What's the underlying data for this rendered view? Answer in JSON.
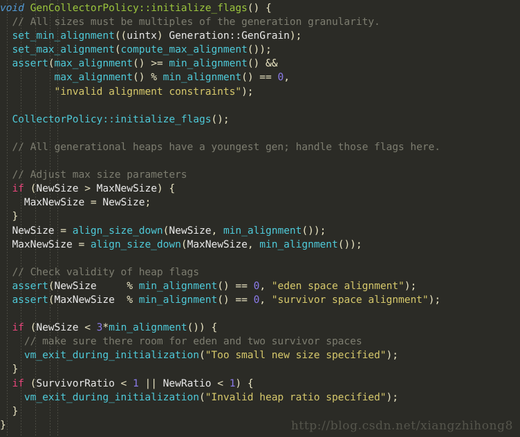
{
  "editor": {
    "language": "C++",
    "background_color": "#2b2b26",
    "font_size_px": 14.6,
    "line_height_px": 20.1,
    "indent_guide_color": "#4a4a42",
    "indent_guide_x": [
      10,
      30,
      51,
      72,
      83
    ]
  },
  "theme": {
    "keyword": "#e8467c",
    "type_keyword": "#529ad6",
    "function": "#4ec9d8",
    "declaration": "#9bc53d",
    "string": "#d6c86b",
    "comment": "#7d7d70",
    "number": "#8a7ae8",
    "plain": "#e8e8e8",
    "punctuation": "#e9e4c2"
  },
  "watermark": {
    "text": "http://blog.csdn.net/xiangzhihong8"
  },
  "code": {
    "lines": [
      {
        "n": 1,
        "tokens": [
          {
            "t": "void",
            "c": "kwt"
          },
          {
            "t": " ",
            "c": "pl"
          },
          {
            "t": "GenCollectorPolicy::initialize_flags",
            "c": "decl"
          },
          {
            "t": "() {",
            "c": "pn"
          }
        ]
      },
      {
        "n": 2,
        "tokens": [
          {
            "t": "  ",
            "c": "pl"
          },
          {
            "t": "// All sizes must be multiples of the generation granularity.",
            "c": "cmt"
          }
        ]
      },
      {
        "n": 3,
        "tokens": [
          {
            "t": "  ",
            "c": "pl"
          },
          {
            "t": "set_min_alignment",
            "c": "fn"
          },
          {
            "t": "((",
            "c": "pn"
          },
          {
            "t": "uintx",
            "c": "pl"
          },
          {
            "t": ") ",
            "c": "pn"
          },
          {
            "t": "Generation::GenGrain",
            "c": "pl"
          },
          {
            "t": ");",
            "c": "pn"
          }
        ]
      },
      {
        "n": 4,
        "tokens": [
          {
            "t": "  ",
            "c": "pl"
          },
          {
            "t": "set_max_alignment",
            "c": "fn"
          },
          {
            "t": "(",
            "c": "pn"
          },
          {
            "t": "compute_max_alignment",
            "c": "fn"
          },
          {
            "t": "());",
            "c": "pn"
          }
        ]
      },
      {
        "n": 5,
        "tokens": [
          {
            "t": "  ",
            "c": "pl"
          },
          {
            "t": "assert",
            "c": "fn"
          },
          {
            "t": "(",
            "c": "pn"
          },
          {
            "t": "max_alignment",
            "c": "fn"
          },
          {
            "t": "() ",
            "c": "pn"
          },
          {
            "t": ">=",
            "c": "op"
          },
          {
            "t": " ",
            "c": "pl"
          },
          {
            "t": "min_alignment",
            "c": "fn"
          },
          {
            "t": "() ",
            "c": "pn"
          },
          {
            "t": "&&",
            "c": "op"
          }
        ]
      },
      {
        "n": 6,
        "tokens": [
          {
            "t": "         ",
            "c": "pl"
          },
          {
            "t": "max_alignment",
            "c": "fn"
          },
          {
            "t": "() ",
            "c": "pn"
          },
          {
            "t": "%",
            "c": "op"
          },
          {
            "t": " ",
            "c": "pl"
          },
          {
            "t": "min_alignment",
            "c": "fn"
          },
          {
            "t": "() ",
            "c": "pn"
          },
          {
            "t": "==",
            "c": "op"
          },
          {
            "t": " ",
            "c": "pl"
          },
          {
            "t": "0",
            "c": "num"
          },
          {
            "t": ",",
            "c": "pn"
          }
        ]
      },
      {
        "n": 7,
        "tokens": [
          {
            "t": "         ",
            "c": "pl"
          },
          {
            "t": "\"invalid alignment constraints\"",
            "c": "str"
          },
          {
            "t": ");",
            "c": "pn"
          }
        ]
      },
      {
        "n": 8,
        "tokens": []
      },
      {
        "n": 9,
        "tokens": [
          {
            "t": "  ",
            "c": "pl"
          },
          {
            "t": "CollectorPolicy::initialize_flags",
            "c": "fn"
          },
          {
            "t": "();",
            "c": "pn"
          }
        ]
      },
      {
        "n": 10,
        "tokens": []
      },
      {
        "n": 11,
        "tokens": [
          {
            "t": "  ",
            "c": "pl"
          },
          {
            "t": "// All generational heaps have a youngest gen; handle those flags here.",
            "c": "cmt"
          }
        ]
      },
      {
        "n": 12,
        "tokens": []
      },
      {
        "n": 13,
        "tokens": [
          {
            "t": "  ",
            "c": "pl"
          },
          {
            "t": "// Adjust max size parameters",
            "c": "cmt"
          }
        ]
      },
      {
        "n": 14,
        "tokens": [
          {
            "t": "  ",
            "c": "pl"
          },
          {
            "t": "if",
            "c": "kw"
          },
          {
            "t": " (",
            "c": "pn"
          },
          {
            "t": "NewSize",
            "c": "pl"
          },
          {
            "t": " ",
            "c": "pl"
          },
          {
            "t": ">",
            "c": "op"
          },
          {
            "t": " ",
            "c": "pl"
          },
          {
            "t": "MaxNewSize",
            "c": "pl"
          },
          {
            "t": ") {",
            "c": "pn"
          }
        ]
      },
      {
        "n": 15,
        "tokens": [
          {
            "t": "    ",
            "c": "pl"
          },
          {
            "t": "MaxNewSize",
            "c": "pl"
          },
          {
            "t": " ",
            "c": "pl"
          },
          {
            "t": "=",
            "c": "op"
          },
          {
            "t": " ",
            "c": "pl"
          },
          {
            "t": "NewSize",
            "c": "pl"
          },
          {
            "t": ";",
            "c": "pn"
          }
        ]
      },
      {
        "n": 16,
        "tokens": [
          {
            "t": "  ",
            "c": "pl"
          },
          {
            "t": "}",
            "c": "pn"
          }
        ]
      },
      {
        "n": 17,
        "tokens": [
          {
            "t": "  ",
            "c": "pl"
          },
          {
            "t": "NewSize",
            "c": "pl"
          },
          {
            "t": " ",
            "c": "pl"
          },
          {
            "t": "=",
            "c": "op"
          },
          {
            "t": " ",
            "c": "pl"
          },
          {
            "t": "align_size_down",
            "c": "fn"
          },
          {
            "t": "(",
            "c": "pn"
          },
          {
            "t": "NewSize",
            "c": "pl"
          },
          {
            "t": ", ",
            "c": "pn"
          },
          {
            "t": "min_alignment",
            "c": "fn"
          },
          {
            "t": "());",
            "c": "pn"
          }
        ]
      },
      {
        "n": 18,
        "tokens": [
          {
            "t": "  ",
            "c": "pl"
          },
          {
            "t": "MaxNewSize",
            "c": "pl"
          },
          {
            "t": " ",
            "c": "pl"
          },
          {
            "t": "=",
            "c": "op"
          },
          {
            "t": " ",
            "c": "pl"
          },
          {
            "t": "align_size_down",
            "c": "fn"
          },
          {
            "t": "(",
            "c": "pn"
          },
          {
            "t": "MaxNewSize",
            "c": "pl"
          },
          {
            "t": ", ",
            "c": "pn"
          },
          {
            "t": "min_alignment",
            "c": "fn"
          },
          {
            "t": "());",
            "c": "pn"
          }
        ]
      },
      {
        "n": 19,
        "tokens": []
      },
      {
        "n": 20,
        "tokens": [
          {
            "t": "  ",
            "c": "pl"
          },
          {
            "t": "// Check validity of heap flags",
            "c": "cmt"
          }
        ]
      },
      {
        "n": 21,
        "tokens": [
          {
            "t": "  ",
            "c": "pl"
          },
          {
            "t": "assert",
            "c": "fn"
          },
          {
            "t": "(",
            "c": "pn"
          },
          {
            "t": "NewSize",
            "c": "pl"
          },
          {
            "t": "     ",
            "c": "pl"
          },
          {
            "t": "%",
            "c": "op"
          },
          {
            "t": " ",
            "c": "pl"
          },
          {
            "t": "min_alignment",
            "c": "fn"
          },
          {
            "t": "() ",
            "c": "pn"
          },
          {
            "t": "==",
            "c": "op"
          },
          {
            "t": " ",
            "c": "pl"
          },
          {
            "t": "0",
            "c": "num"
          },
          {
            "t": ", ",
            "c": "pn"
          },
          {
            "t": "\"eden space alignment\"",
            "c": "str"
          },
          {
            "t": ");",
            "c": "pn"
          }
        ]
      },
      {
        "n": 22,
        "tokens": [
          {
            "t": "  ",
            "c": "pl"
          },
          {
            "t": "assert",
            "c": "fn"
          },
          {
            "t": "(",
            "c": "pn"
          },
          {
            "t": "MaxNewSize",
            "c": "pl"
          },
          {
            "t": "  ",
            "c": "pl"
          },
          {
            "t": "%",
            "c": "op"
          },
          {
            "t": " ",
            "c": "pl"
          },
          {
            "t": "min_alignment",
            "c": "fn"
          },
          {
            "t": "() ",
            "c": "pn"
          },
          {
            "t": "==",
            "c": "op"
          },
          {
            "t": " ",
            "c": "pl"
          },
          {
            "t": "0",
            "c": "num"
          },
          {
            "t": ", ",
            "c": "pn"
          },
          {
            "t": "\"survivor space alignment\"",
            "c": "str"
          },
          {
            "t": ");",
            "c": "pn"
          }
        ]
      },
      {
        "n": 23,
        "tokens": []
      },
      {
        "n": 24,
        "tokens": [
          {
            "t": "  ",
            "c": "pl"
          },
          {
            "t": "if",
            "c": "kw"
          },
          {
            "t": " (",
            "c": "pn"
          },
          {
            "t": "NewSize",
            "c": "pl"
          },
          {
            "t": " ",
            "c": "pl"
          },
          {
            "t": "<",
            "c": "op"
          },
          {
            "t": " ",
            "c": "pl"
          },
          {
            "t": "3",
            "c": "num"
          },
          {
            "t": "*",
            "c": "op"
          },
          {
            "t": "min_alignment",
            "c": "fn"
          },
          {
            "t": "()) {",
            "c": "pn"
          }
        ]
      },
      {
        "n": 25,
        "tokens": [
          {
            "t": "    ",
            "c": "pl"
          },
          {
            "t": "// make sure there room for eden and two survivor spaces",
            "c": "cmt"
          }
        ]
      },
      {
        "n": 26,
        "tokens": [
          {
            "t": "    ",
            "c": "pl"
          },
          {
            "t": "vm_exit_during_initialization",
            "c": "fn"
          },
          {
            "t": "(",
            "c": "pn"
          },
          {
            "t": "\"Too small new size specified\"",
            "c": "str"
          },
          {
            "t": ");",
            "c": "pn"
          }
        ]
      },
      {
        "n": 27,
        "tokens": [
          {
            "t": "  ",
            "c": "pl"
          },
          {
            "t": "}",
            "c": "pn"
          }
        ]
      },
      {
        "n": 28,
        "tokens": [
          {
            "t": "  ",
            "c": "pl"
          },
          {
            "t": "if",
            "c": "kw"
          },
          {
            "t": " (",
            "c": "pn"
          },
          {
            "t": "SurvivorRatio",
            "c": "pl"
          },
          {
            "t": " ",
            "c": "pl"
          },
          {
            "t": "<",
            "c": "op"
          },
          {
            "t": " ",
            "c": "pl"
          },
          {
            "t": "1",
            "c": "num"
          },
          {
            "t": " ",
            "c": "pl"
          },
          {
            "t": "||",
            "c": "op"
          },
          {
            "t": " ",
            "c": "pl"
          },
          {
            "t": "NewRatio",
            "c": "pl"
          },
          {
            "t": " ",
            "c": "pl"
          },
          {
            "t": "<",
            "c": "op"
          },
          {
            "t": " ",
            "c": "pl"
          },
          {
            "t": "1",
            "c": "num"
          },
          {
            "t": ") {",
            "c": "pn"
          }
        ]
      },
      {
        "n": 29,
        "tokens": [
          {
            "t": "    ",
            "c": "pl"
          },
          {
            "t": "vm_exit_during_initialization",
            "c": "fn"
          },
          {
            "t": "(",
            "c": "pn"
          },
          {
            "t": "\"Invalid heap ratio specified\"",
            "c": "str"
          },
          {
            "t": ");",
            "c": "pn"
          }
        ]
      },
      {
        "n": 30,
        "tokens": [
          {
            "t": "  ",
            "c": "pl"
          },
          {
            "t": "}",
            "c": "pn"
          }
        ]
      },
      {
        "n": 31,
        "tokens": [
          {
            "t": "}",
            "c": "pn"
          }
        ]
      }
    ]
  }
}
